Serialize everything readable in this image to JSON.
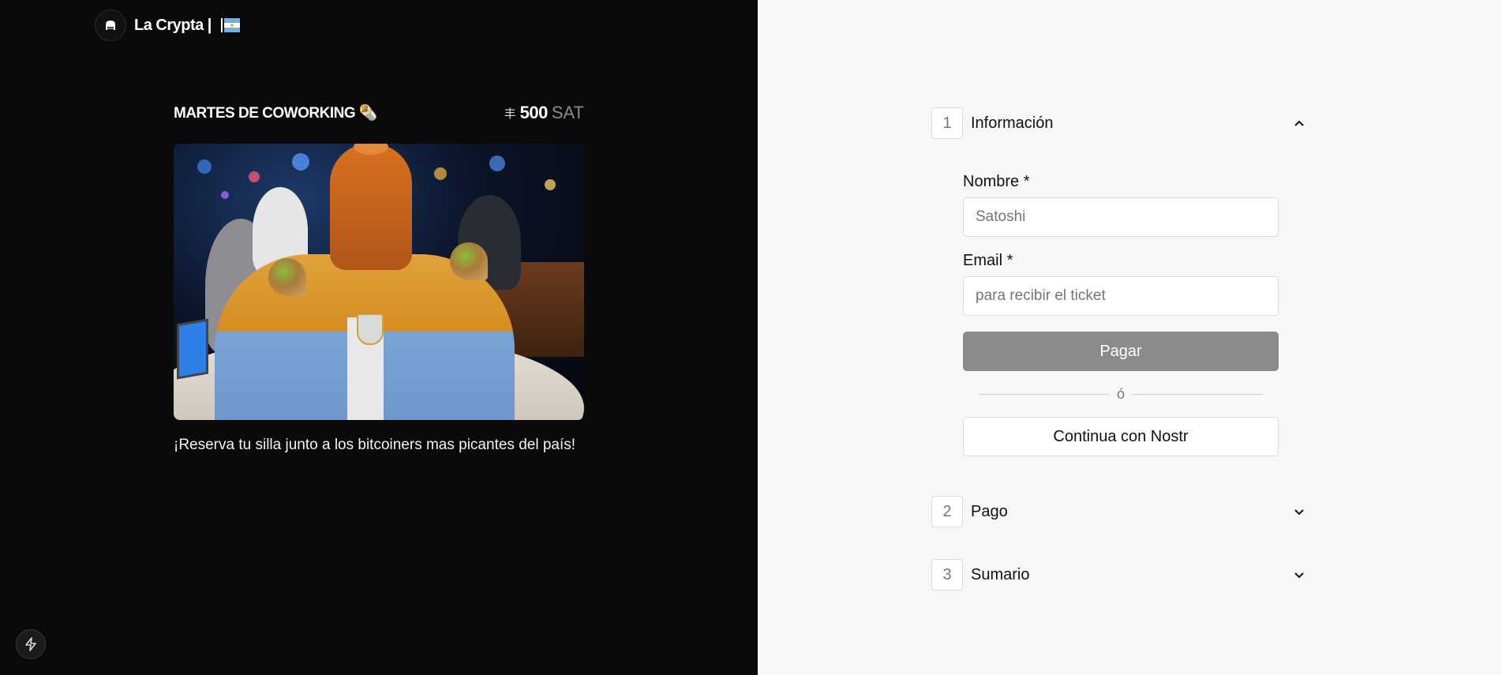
{
  "brand": {
    "name": "La Crypta |",
    "flag_icon": "argentina-flag-icon",
    "logo_icon": "la-crypta-logo-icon"
  },
  "event": {
    "title": "MARTES DE COWORKING 🌯",
    "price": {
      "symbol": "丰",
      "amount": "500",
      "unit": "SAT"
    },
    "image_icon": "event-photo",
    "description": "¡Reserva tu silla junto a los bitcoiners mas picantes del país!"
  },
  "footer": {
    "bolt_icon": "lightning-bolt-icon"
  },
  "steps": [
    {
      "number": "1",
      "label": "Información",
      "state": "expanded"
    },
    {
      "number": "2",
      "label": "Pago",
      "state": "collapsed"
    },
    {
      "number": "3",
      "label": "Sumario",
      "state": "collapsed"
    }
  ],
  "form": {
    "name_label": "Nombre *",
    "name_placeholder": "Satoshi",
    "name_value": "",
    "email_label": "Email *",
    "email_placeholder": "para recibir el ticket",
    "email_value": "",
    "pay_label": "Pagar",
    "divider_text": "ó",
    "nostr_label": "Continua con Nostr"
  },
  "colors": {
    "left_bg": "#0a0a0a",
    "right_bg": "#f7f7f7",
    "pay_button": "#8b8b8b"
  }
}
